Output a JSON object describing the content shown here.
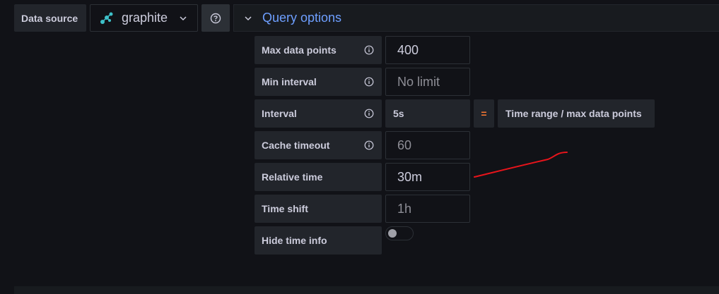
{
  "datasource": {
    "label": "Data source",
    "selected": "graphite",
    "icon": "graphite-icon",
    "help_icon": "question-circle-icon"
  },
  "query_options": {
    "title": "Query options",
    "expanded": true,
    "rows": [
      {
        "label": "Max data points",
        "value": "400",
        "placeholder": "",
        "has_info": true
      },
      {
        "label": "Min interval",
        "value": "",
        "placeholder": "No limit",
        "has_info": true
      },
      {
        "label": "Interval",
        "value": "5s",
        "placeholder": "",
        "has_info": true
      },
      {
        "label": "Cache timeout",
        "value": "",
        "placeholder": "60",
        "has_info": true
      },
      {
        "label": "Relative time",
        "value": "30m",
        "placeholder": "",
        "has_info": false
      },
      {
        "label": "Time shift",
        "value": "",
        "placeholder": "1h",
        "has_info": false
      },
      {
        "label": "Hide time info",
        "value": "",
        "placeholder": "",
        "has_info": false
      }
    ],
    "interval_equals": "=",
    "interval_formula": "Time range / max data points",
    "hide_time_info_enabled": false
  },
  "colors": {
    "accent_blue": "#6e9fff",
    "equals_orange": "#ff7a33",
    "annotation_red": "#e8141b"
  }
}
